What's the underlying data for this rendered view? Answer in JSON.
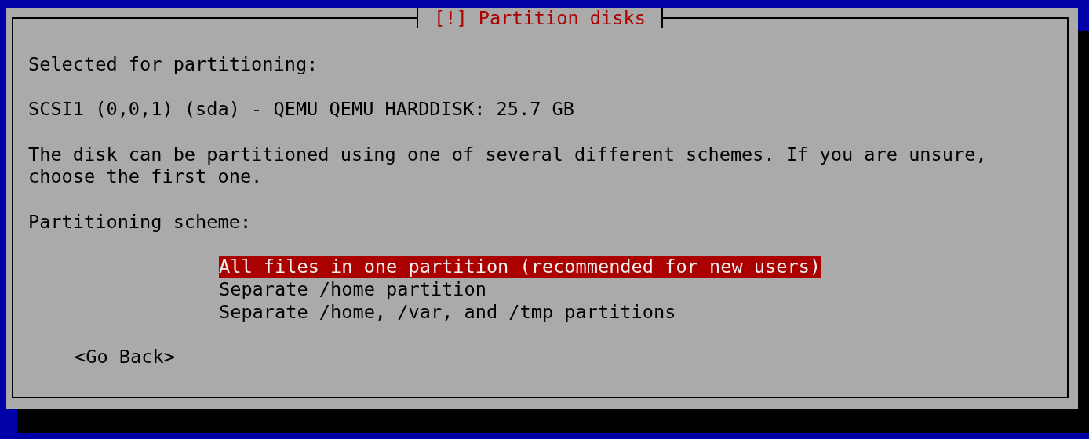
{
  "dialog": {
    "title": "[!] Partition disks",
    "texts": [
      "Selected for partitioning:",
      "SCSI1 (0,0,1) (sda) - QEMU QEMU HARDDISK: 25.7 GB",
      "The disk can be partitioned using one of several different schemes. If you are unsure, choose the first one."
    ],
    "prompt": "Partitioning scheme:",
    "options": [
      {
        "label": "All files in one partition (recommended for new users)",
        "selected": true
      },
      {
        "label": "Separate /home partition",
        "selected": false
      },
      {
        "label": "Separate /home, /var, and /tmp partitions",
        "selected": false
      }
    ],
    "buttons": [
      "<Go Back>"
    ]
  }
}
